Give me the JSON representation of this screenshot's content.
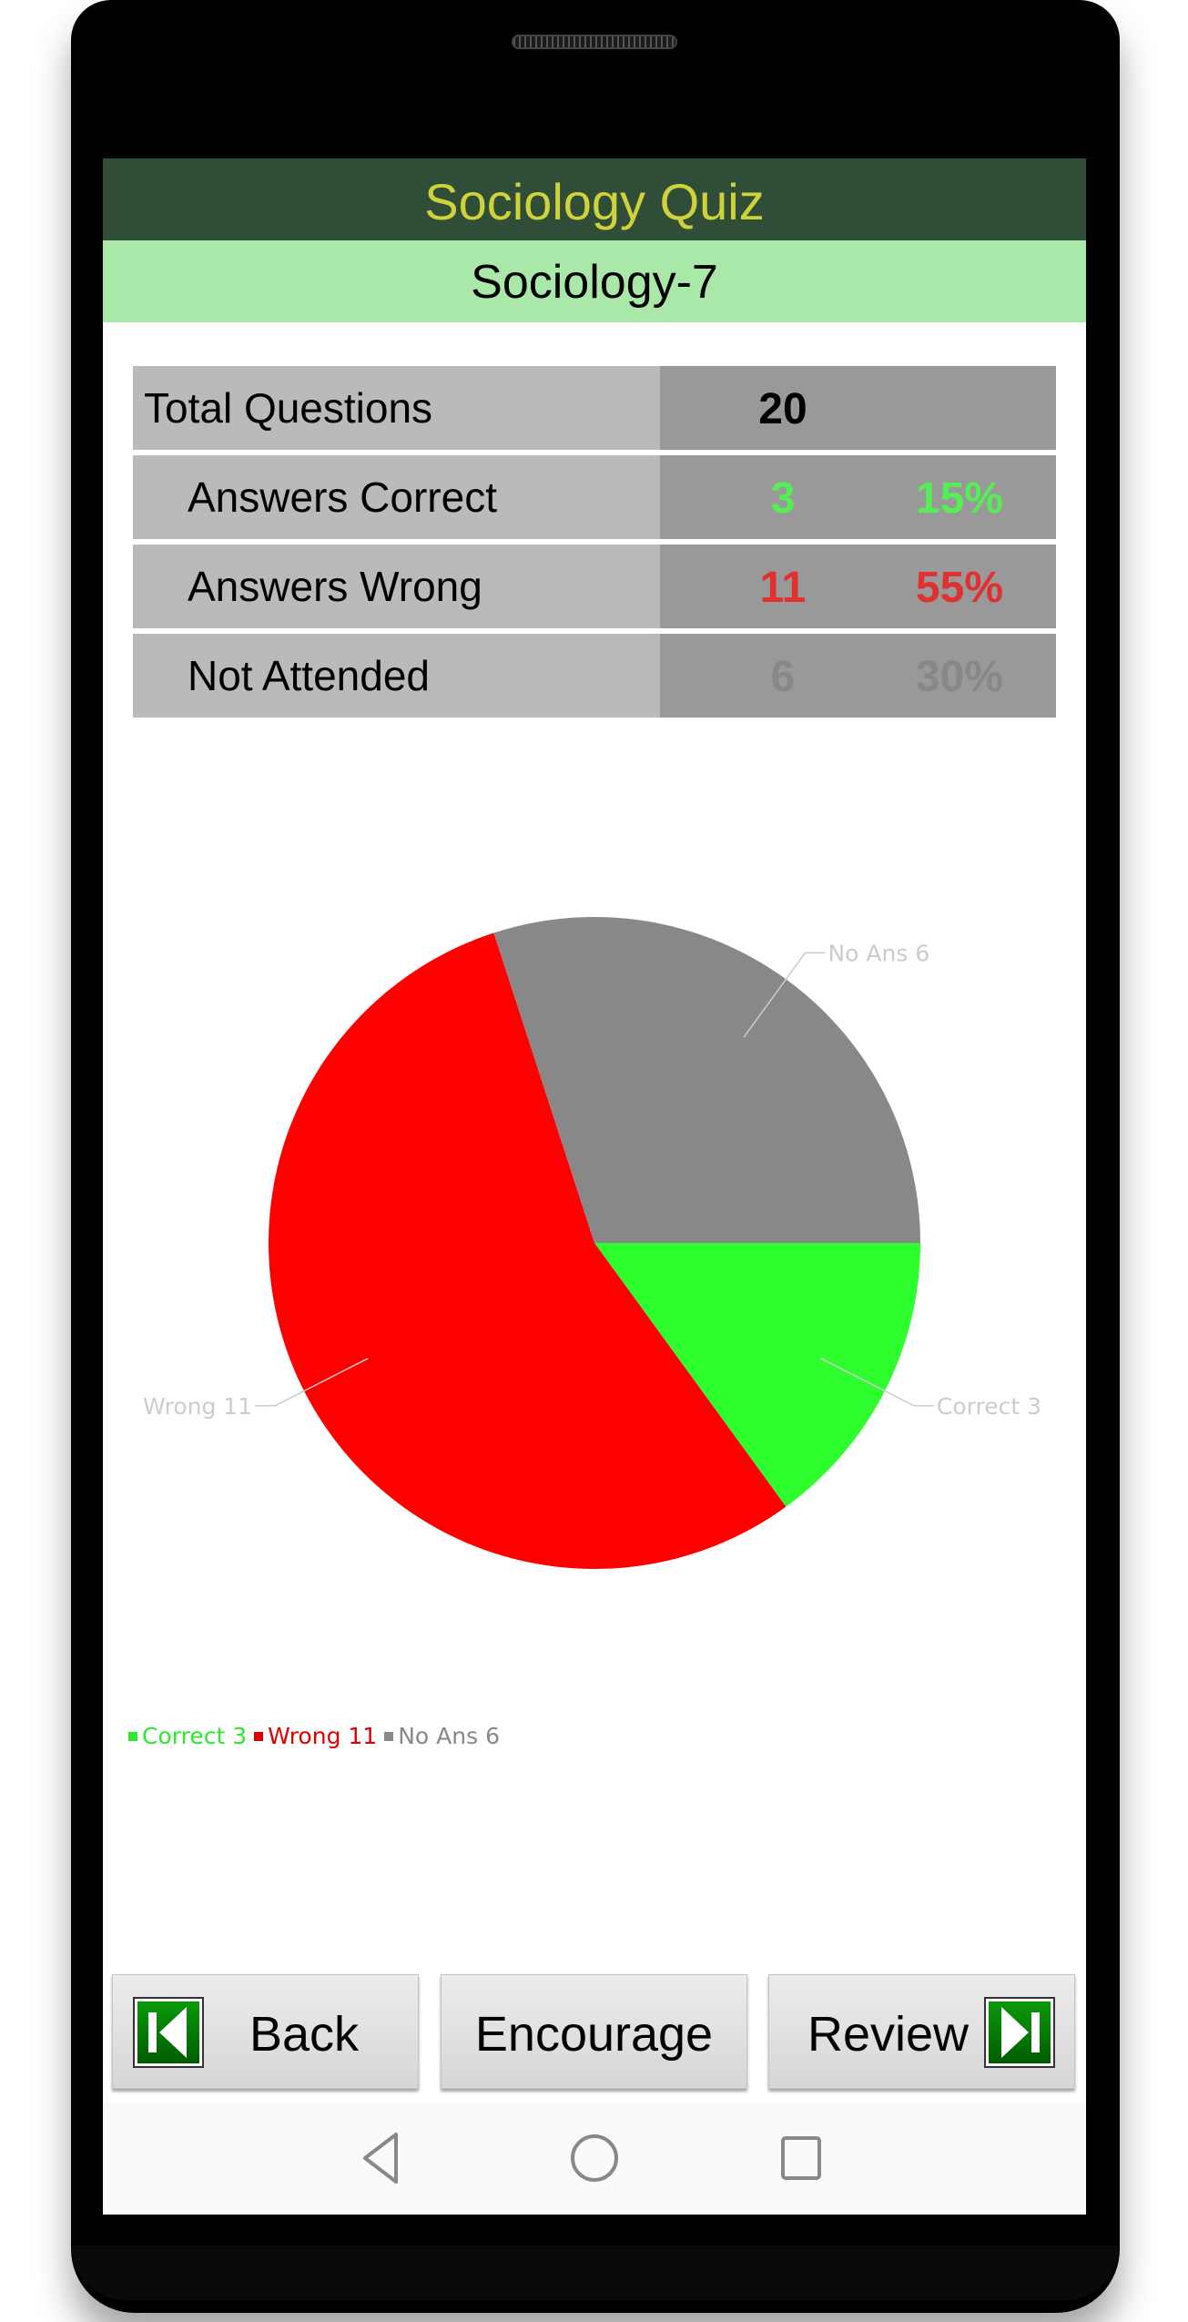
{
  "app": {
    "title": "Sociology Quiz",
    "subtitle": "Sociology-7",
    "header_bg": "#304d37",
    "title_color": "#cfd23a",
    "subheader_bg": "#a9e8a9"
  },
  "stats": {
    "total": {
      "label": "Total Questions",
      "count": "20"
    },
    "correct": {
      "label": "Answers Correct",
      "count": "3",
      "percent": "15%",
      "color": "#55ee55"
    },
    "wrong": {
      "label": "Answers Wrong",
      "count": "11",
      "percent": "55%",
      "color": "#e03030"
    },
    "not_attended": {
      "label": "Not Attended",
      "count": "6",
      "percent": "30%",
      "color": "#888888"
    }
  },
  "chart_data": {
    "type": "pie",
    "title": "",
    "start_angle_deg": 0,
    "direction": "clockwise",
    "slices": [
      {
        "label": "Correct",
        "value": 3,
        "color": "#2efe2e",
        "callout": "Correct 3"
      },
      {
        "label": "Wrong",
        "value": 11,
        "color": "#ff0000",
        "callout": "Wrong 11"
      },
      {
        "label": "No Ans",
        "value": 6,
        "color": "#888888",
        "callout": "No Ans 6"
      }
    ],
    "legend": {
      "placement": "bottom-left",
      "entries": [
        {
          "text": "Correct 3",
          "color": "#2ee82e"
        },
        {
          "text": "Wrong 11",
          "color": "#e00000"
        },
        {
          "text": "No Ans 6",
          "color": "#888888"
        }
      ]
    },
    "callout_color": "#cccccc"
  },
  "buttons": {
    "back": "Back",
    "encourage": "Encourage",
    "review": "Review"
  },
  "icons": {
    "back": "skip-back-icon",
    "review": "skip-forward-icon",
    "nav_back": "nav-back-triangle-icon",
    "nav_home": "nav-home-circle-icon",
    "nav_recents": "nav-recents-square-icon"
  }
}
